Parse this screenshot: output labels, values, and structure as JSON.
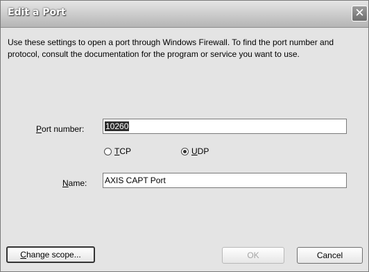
{
  "window": {
    "title": "Edit a Port",
    "close_glyph": "✕"
  },
  "description": "Use these settings to open a port through Windows Firewall. To find the port number and protocol, consult the documentation for the program or service you want to use.",
  "port": {
    "label_mnemonic": "P",
    "label_rest": "ort number:",
    "value": "10260"
  },
  "protocol": {
    "tcp": {
      "mnemonic": "T",
      "rest": "CP",
      "checked": false
    },
    "udp": {
      "mnemonic": "U",
      "rest": "DP",
      "checked": true
    }
  },
  "name": {
    "label_mnemonic": "N",
    "label_rest": "ame:",
    "value": "AXIS CAPT Port"
  },
  "buttons": {
    "change_scope_mnemonic": "C",
    "change_scope_rest": "hange scope...",
    "ok": "OK",
    "cancel": "Cancel"
  },
  "icons": {
    "close": "close-icon",
    "radio": "radio-icon"
  }
}
